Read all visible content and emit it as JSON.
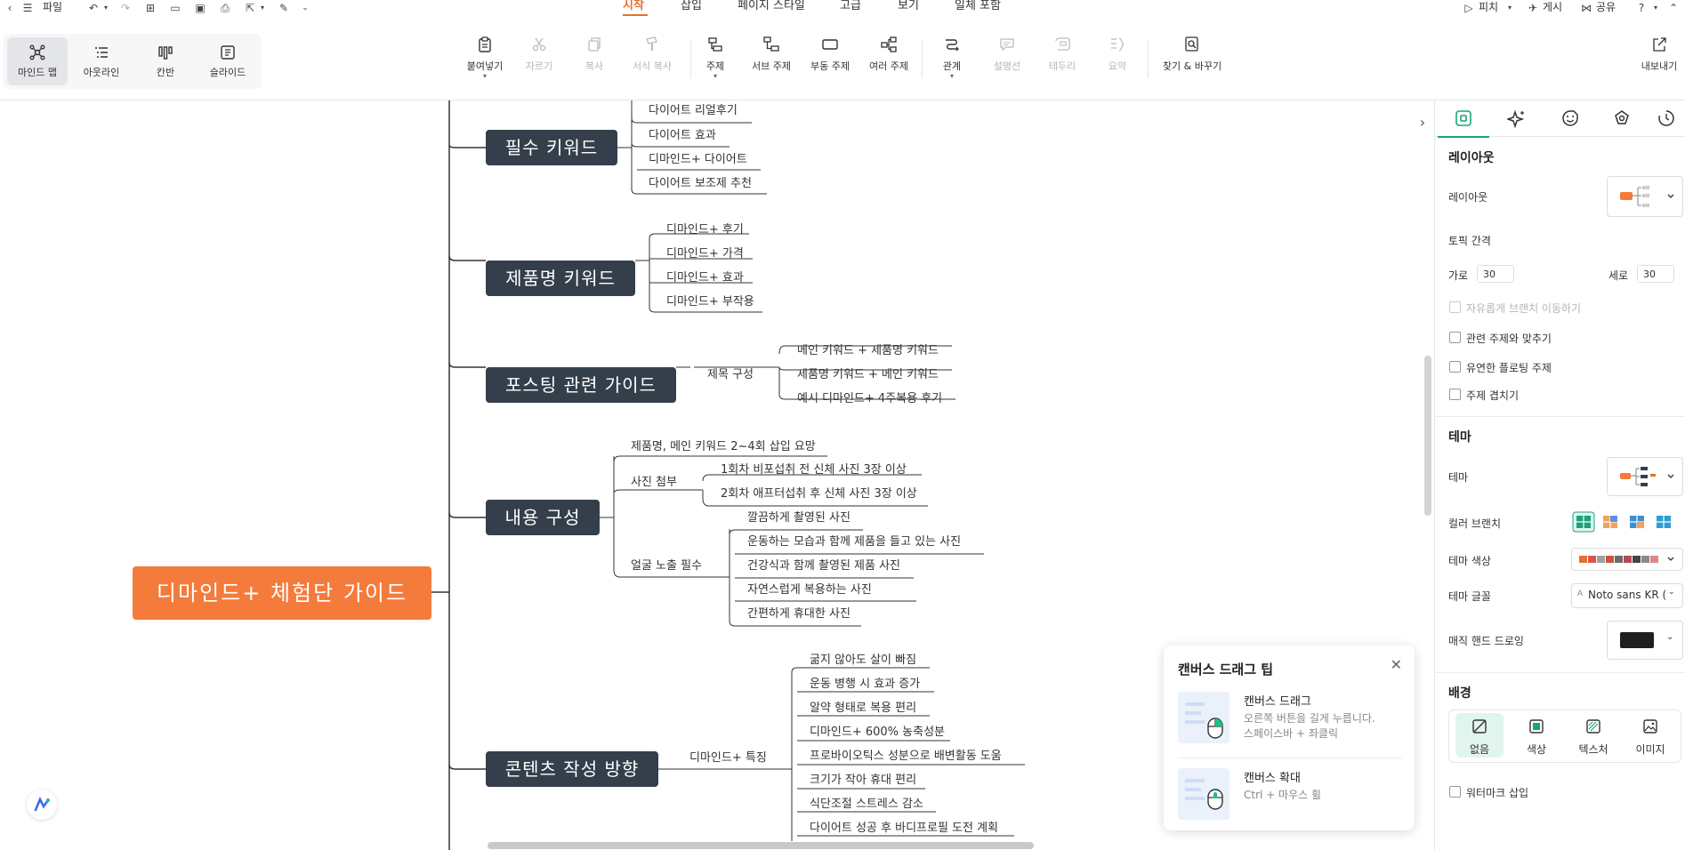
{
  "menubar": {
    "file_label": "파일",
    "tabs": [
      "시작",
      "삽입",
      "페이지 스타일",
      "고급",
      "보기",
      "일체 포함"
    ],
    "active_tab": "시작",
    "right": {
      "pitch": "피치",
      "publish": "게시",
      "share": "공유"
    }
  },
  "toolbar": {
    "view_modes": [
      "마인드 맵",
      "아웃라인",
      "칸반",
      "슬라이드"
    ],
    "active_view": "마인드 맵",
    "buttons": [
      "붙여넣기",
      "자르기",
      "복사",
      "서식 복사",
      "주제",
      "서브 주제",
      "부동 주제",
      "여러 주제",
      "관계",
      "설명선",
      "테두리",
      "요약",
      "찾기 & 바꾸기"
    ],
    "disabled": [
      "자르기",
      "복사",
      "서식 복사",
      "설명선",
      "테두리",
      "요약"
    ],
    "export_label": "내보내기"
  },
  "mindmap": {
    "root": "디마인드+ 체험단 가이드",
    "branches": [
      {
        "title": "필수 키워드",
        "leaves": [
          "다이어트 리얼후기",
          "다이어트 효과",
          "디마인드+ 다이어트",
          "다이어트 보조제 추천"
        ]
      },
      {
        "title": "제품명 키워드",
        "leaves": [
          "디마인드+ 후기",
          "디마인드+ 가격",
          "디마인드+ 효과",
          "디마인드+ 부작용"
        ]
      },
      {
        "title": "포스팅 관련 가이드",
        "sub": "제목 구성",
        "leaves": [
          "메인 키워드 + 제품명 키워드",
          "제품명 키워드 + 메인 키워드",
          "예시 디마인드+ 4주복용 후기"
        ]
      },
      {
        "title": "내용 구성",
        "top_leaf": "제품명, 메인 키워드 2~4회 삽입 요망",
        "sub1": "사진 첨부",
        "sub1_leaves": [
          "1회차 비포섭취 전 신체 사진 3장 이상",
          "2회차 애프터섭취 후 신체 사진 3장 이상"
        ],
        "sub2": "얼굴 노출 필수",
        "sub2_leaves": [
          "깔끔하게 촬영된 사진",
          "운동하는 모습과 함께 제품을 들고 있는 사진",
          "건강식과 함께 촬영된 제품 사진",
          "자연스럽게 복용하는 사진",
          "간편하게 휴대한 사진"
        ]
      },
      {
        "title": "콘텐츠 작성 방향",
        "sub": "디마인드+ 특징",
        "leaves": [
          "굶지 않아도 살이 빠짐",
          "운동 병행 시 효과 증가",
          "알약 형태로 복용 편리",
          "디마인드+ 600% 농축성분",
          "프로바이오틱스 성분으로 배변활동 도움",
          "크기가 작아 휴대 편리",
          "식단조절 스트레스 감소",
          "다이어트 성공 후 바디프로필 도전 계획"
        ]
      }
    ]
  },
  "tip": {
    "title": "캔버스 드래그 팁",
    "items": [
      {
        "heading": "캔버스 드래그",
        "desc": "오른쪽 버튼을 길게 누릅니다.\n스페이스바 + 좌클릭"
      },
      {
        "heading": "캔버스 확대",
        "desc": "Ctrl + 마우스 휠"
      }
    ]
  },
  "panel": {
    "layout_section": "레이아웃",
    "layout_label": "레이아웃",
    "spacing_label": "토픽 간격",
    "horizontal_label": "가로",
    "horizontal_value": "30",
    "vertical_label": "세로",
    "vertical_value": "30",
    "checks": [
      {
        "label": "자유롭게 브랜치 이동하기",
        "disabled": true
      },
      {
        "label": "관련 주제와 맞추기",
        "disabled": false
      },
      {
        "label": "유연한 플로팅 주제",
        "disabled": false
      },
      {
        "label": "주제 겹치기",
        "disabled": false
      }
    ],
    "theme_section": "테마",
    "theme_label": "테마",
    "color_branch_label": "컬러 브랜치",
    "theme_color_label": "테마 색상",
    "theme_font_label": "테마 글꼴",
    "theme_font_value": "Noto sans KR (",
    "magic_pen_label": "매직 핸드 드로잉",
    "background_section": "배경",
    "bg_options": [
      "없음",
      "색상",
      "텍스처",
      "이미지"
    ],
    "active_bg": "없음",
    "watermark_label": "워터마크 삽입"
  },
  "colors": {
    "accent": "#e8702f",
    "root": "#f47b3b",
    "node": "#343f4b",
    "panel_accent": "#1aa37a"
  }
}
